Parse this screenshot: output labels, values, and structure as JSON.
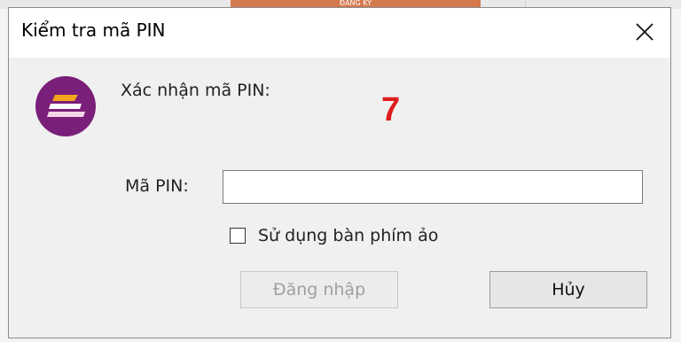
{
  "background": {
    "top_button_label": "ĐĂNG KÝ"
  },
  "dialog": {
    "title": "Kiểm tra mã PIN",
    "confirm_label": "Xác nhận mã PIN:",
    "countdown": "7",
    "pin_label": "Mã PIN:",
    "pin_value": "",
    "virtual_keyboard_label": "Sử dụng bàn phím ảo",
    "virtual_keyboard_checked": false,
    "login_button": "Đăng nhập",
    "cancel_button": "Hủy"
  },
  "colors": {
    "logo": "#7a1f79",
    "logo_stripes": [
      "#f2a51d",
      "#ffffff",
      "#f3d6e6"
    ],
    "countdown": "#e01b1b"
  }
}
